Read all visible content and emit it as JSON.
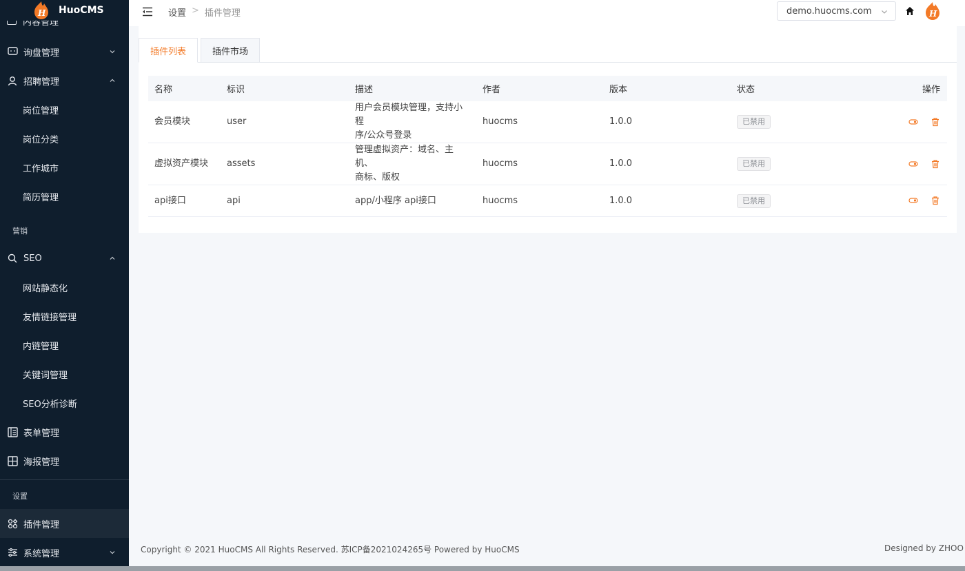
{
  "brand": {
    "name": "HuoCMS",
    "logo_icon": "flame-h-logo",
    "accent": "#f37a27"
  },
  "sidebar": {
    "items": [
      {
        "label": "询盘管理",
        "icon": "message-icon",
        "arrow": "down"
      },
      {
        "label": "招聘管理",
        "icon": "user-icon",
        "arrow": "up"
      },
      {
        "label": "岗位管理"
      },
      {
        "label": "岗位分类"
      },
      {
        "label": "工作城市"
      },
      {
        "label": "简历管理"
      },
      {
        "label": "SEO",
        "icon": "search-icon",
        "arrow": "up"
      },
      {
        "label": "网站静态化"
      },
      {
        "label": "友情链接管理"
      },
      {
        "label": "内链管理"
      },
      {
        "label": "关键词管理"
      },
      {
        "label": "SEO分析诊断"
      },
      {
        "label": "表单管理",
        "icon": "form-icon"
      },
      {
        "label": "海报管理",
        "icon": "layout-icon"
      },
      {
        "label": "插件管理",
        "icon": "plugin-icon",
        "active": true
      },
      {
        "label": "系统管理",
        "icon": "sliders-icon",
        "arrow": "down"
      }
    ],
    "groups": {
      "marketing": "营销",
      "settings": "设置"
    }
  },
  "header": {
    "breadcrumb": [
      "设置",
      "插件管理"
    ],
    "breadcrumb_sep": ">",
    "site_select": "demo.huocms.com"
  },
  "tabs": [
    {
      "label": "插件列表",
      "active": true
    },
    {
      "label": "插件市场",
      "active": false
    }
  ],
  "table": {
    "columns": [
      "名称",
      "标识",
      "描述",
      "作者",
      "版本",
      "状态",
      "操作"
    ],
    "rows": [
      {
        "name": "会员模块",
        "key": "user",
        "desc_1": "用户会员模块管理，支持小程",
        "desc_2": "序/公众号登录",
        "author": "huocms",
        "version": "1.0.0",
        "status": "已禁用"
      },
      {
        "name": "虚拟资产模块",
        "key": "assets",
        "desc_1": "管理虚拟资产：域名、主机、",
        "desc_2": "商标、版权",
        "author": "huocms",
        "version": "1.0.0",
        "status": "已禁用"
      },
      {
        "name": "api接口",
        "key": "api",
        "desc_1": "app/小程序 api接口",
        "desc_2": "",
        "author": "huocms",
        "version": "1.0.0",
        "status": "已禁用"
      }
    ]
  },
  "footer": {
    "copyright": "Copyright © 2021 HuoCMS All Rights Reserved. 苏ICP备2021024265号 Powered by HuoCMS",
    "designed": "Designed by ZHOO"
  }
}
